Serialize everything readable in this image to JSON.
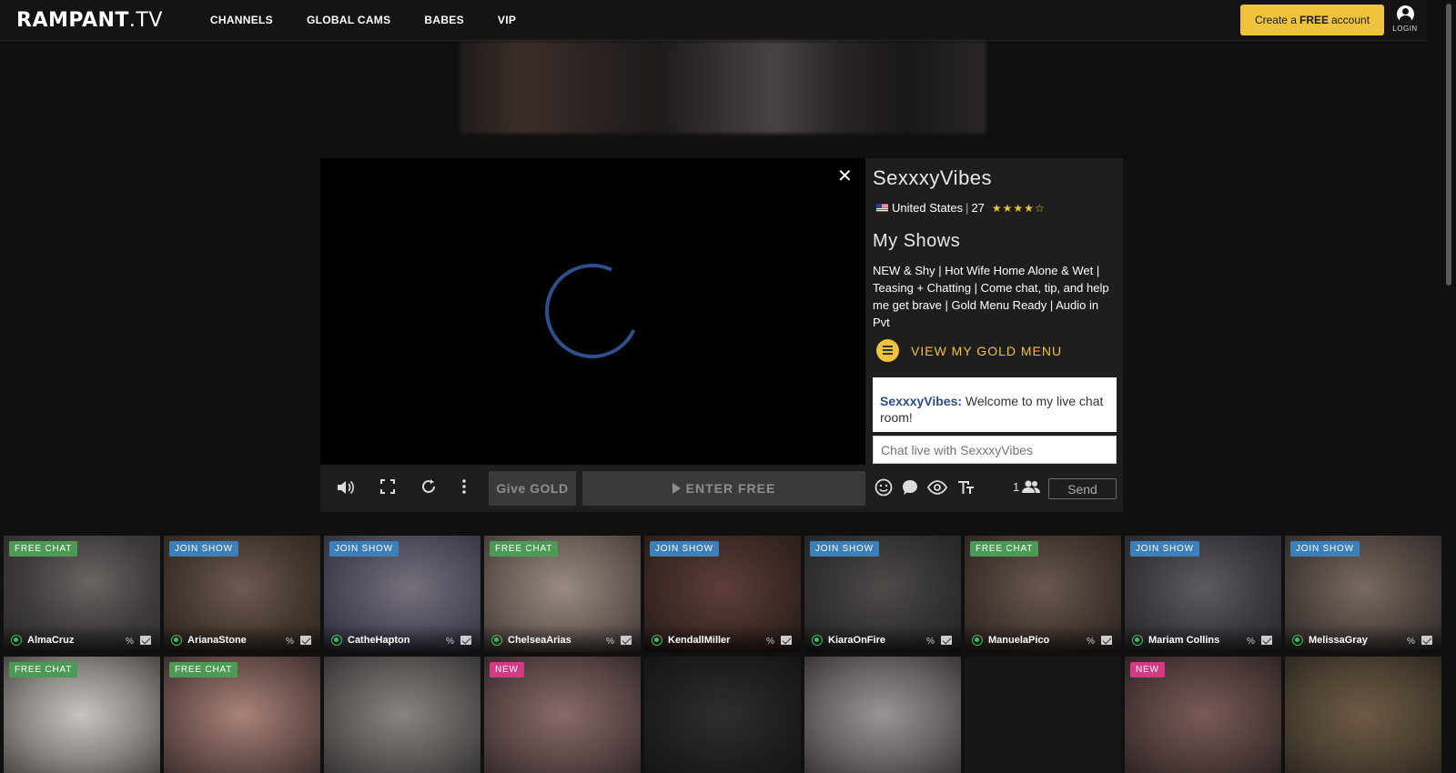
{
  "header": {
    "logo_main": "RAMPANT",
    "logo_suffix": ".TV",
    "nav": [
      "CHANNELS",
      "GLOBAL CAMS",
      "BABES",
      "VIP"
    ],
    "create_prefix": "Create a",
    "create_bold": "FREE",
    "create_suffix": "account",
    "login": "LOGIN"
  },
  "player": {
    "close": "✕",
    "give_gold": "Give GOLD",
    "enter_free": "ENTER FREE"
  },
  "model": {
    "name": "SexxxyVibes",
    "country": "United States",
    "separator": "|",
    "age": "27",
    "stars": "★★★★☆",
    "rating": 4,
    "shows_title": "My Shows",
    "shows_desc": "NEW & Shy | Hot Wife Home Alone & Wet | Teasing + Chatting | Come chat, tip, and help me get brave | Gold Menu Ready | Audio in Pvt",
    "gold_menu": "VIEW MY GOLD MENU"
  },
  "chat": {
    "sender": "SexxxyVibes:",
    "message": "Welcome to my live chat room!",
    "placeholder": "Chat live with SexxxyVibes",
    "viewers": "1",
    "send": "Send"
  },
  "tiles_row1": [
    {
      "badge": "FREE CHAT",
      "name": "AlmaCruz"
    },
    {
      "badge": "JOIN SHOW",
      "name": "ArianaStone"
    },
    {
      "badge": "JOIN SHOW",
      "name": "CatheHapton"
    },
    {
      "badge": "FREE CHAT",
      "name": "ChelseaArias"
    },
    {
      "badge": "JOIN SHOW",
      "name": "KendallMiller"
    },
    {
      "badge": "JOIN SHOW",
      "name": "KiaraOnFire"
    },
    {
      "badge": "FREE CHAT",
      "name": "ManuelaPico"
    },
    {
      "badge": "JOIN SHOW",
      "name": "Mariam Collins"
    },
    {
      "badge": "JOIN SHOW",
      "name": "MelissaGray"
    }
  ],
  "tiles_row2": [
    {
      "badge": "FREE CHAT"
    },
    {
      "badge": "FREE CHAT"
    },
    {
      "badge": ""
    },
    {
      "badge": "NEW"
    },
    {
      "badge": ""
    },
    {
      "badge": ""
    },
    {
      "badge": ""
    },
    {
      "badge": "NEW"
    },
    {
      "badge": ""
    }
  ],
  "colors": {
    "accent_gold": "#f0c33c",
    "free_chat": "#4c9a55",
    "join_show": "#3d7fb8",
    "new": "#d23a82",
    "chat_name": "#2a4a8c"
  }
}
